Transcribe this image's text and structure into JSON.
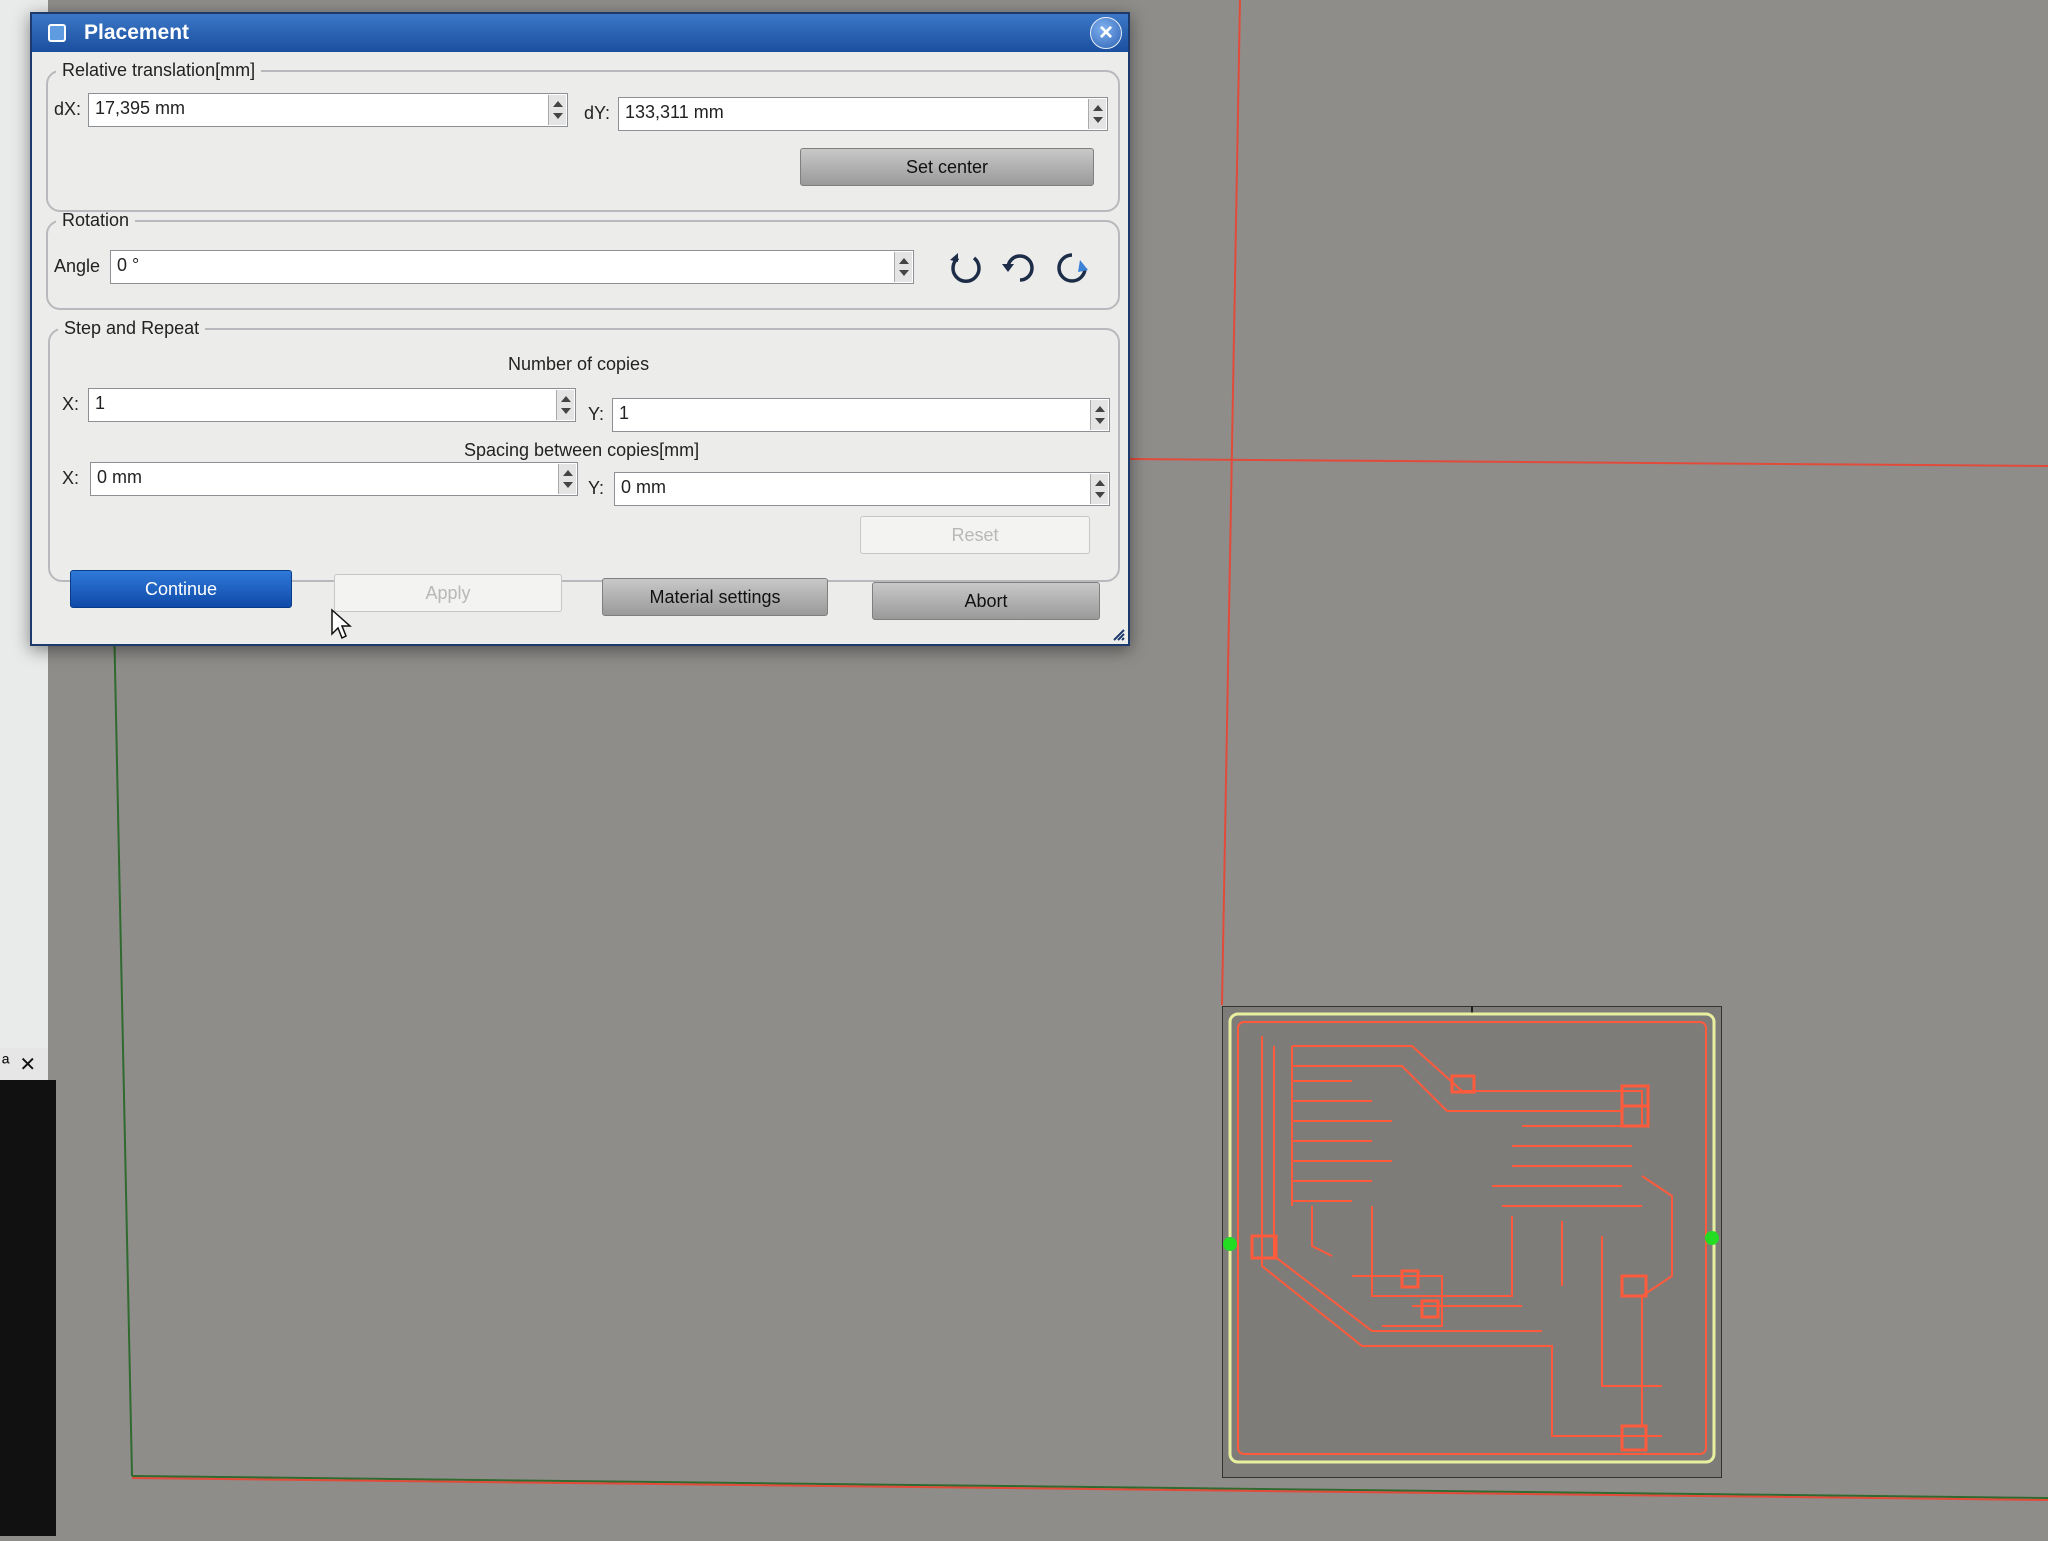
{
  "dialog": {
    "title": "Placement",
    "translation": {
      "legend": "Relative translation[mm]",
      "dx_label": "dX:",
      "dx_value": "17,395 mm",
      "dy_label": "dY:",
      "dy_value": "133,311 mm",
      "set_center_label": "Set center"
    },
    "rotation": {
      "legend": "Rotation",
      "angle_label": "Angle",
      "angle_value": "0 °",
      "icons": [
        "rotate-ccw-icon",
        "rotate-180-icon",
        "rotate-cw-icon"
      ]
    },
    "step_repeat": {
      "legend": "Step and Repeat",
      "copies_heading": "Number of copies",
      "copies_x_label": "X:",
      "copies_x_value": "1",
      "copies_y_label": "Y:",
      "copies_y_value": "1",
      "spacing_heading": "Spacing between copies[mm]",
      "spacing_x_label": "X:",
      "spacing_x_value": "0 mm",
      "spacing_y_label": "Y:",
      "spacing_y_value": "0 mm",
      "reset_label": "Reset"
    },
    "buttons": {
      "continue_label": "Continue",
      "apply_label": "Apply",
      "material_label": "Material settings",
      "abort_label": "Abort"
    }
  },
  "dock_panel": {
    "pin_glyph": "ª",
    "close_glyph": "✕"
  },
  "colors": {
    "canvas": "#8e8d8a",
    "guide_line": "#e24b3a",
    "pcb_trace": "#ff5a3c",
    "pcb_outline": "#e8f0a0",
    "handle": "#22dd22",
    "title_bar": "#1a4f9e"
  }
}
